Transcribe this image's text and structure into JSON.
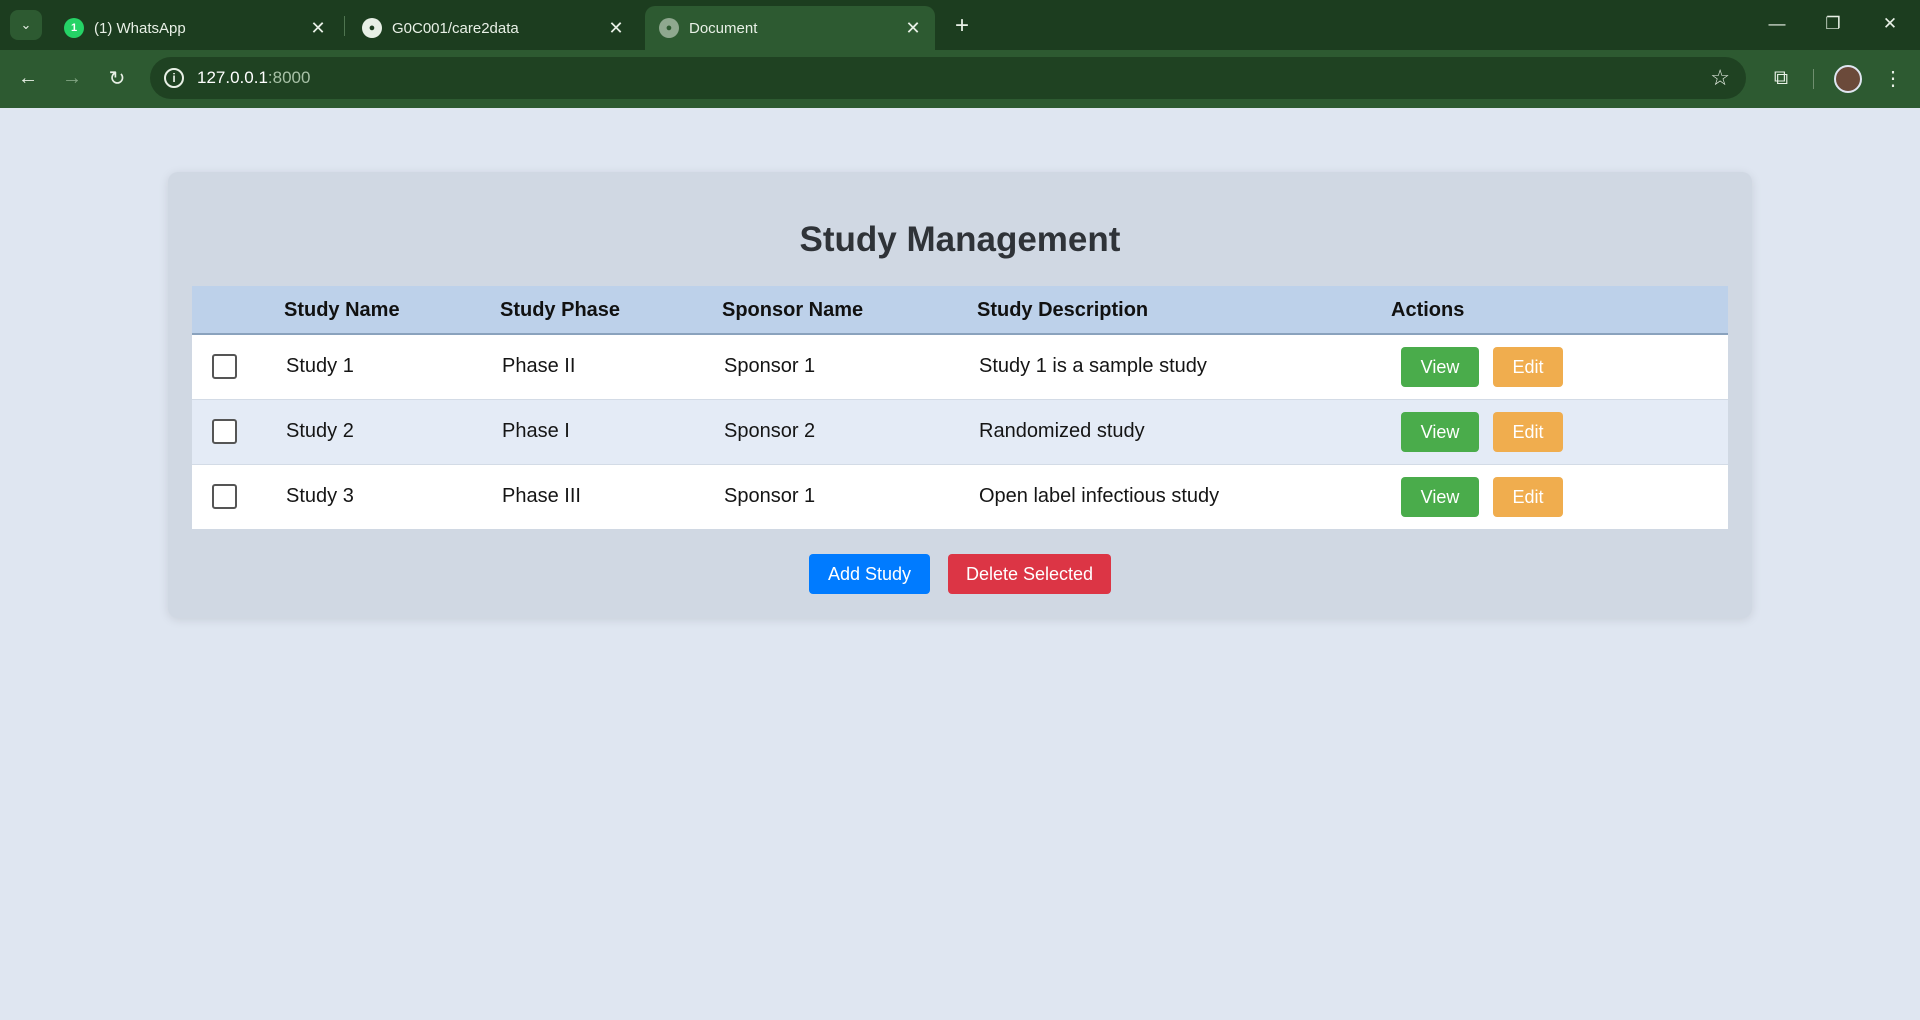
{
  "browser": {
    "tabs": [
      {
        "label": "(1) WhatsApp",
        "icon": "whatsapp-icon",
        "active": false
      },
      {
        "label": "G0C001/care2data",
        "icon": "github-icon",
        "active": false
      },
      {
        "label": "Document",
        "icon": "globe-icon",
        "active": true
      }
    ],
    "url_host": "127.0.0.1",
    "url_port": ":8000"
  },
  "page": {
    "title": "Study Management",
    "columns": [
      "",
      "Study Name",
      "Study Phase",
      "Sponsor Name",
      "Study Description",
      "Actions"
    ],
    "rows": [
      {
        "name": "Study 1",
        "phase": "Phase II",
        "sponsor": "Sponsor 1",
        "description": "Study 1 is a sample study",
        "checked": false
      },
      {
        "name": "Study 2",
        "phase": "Phase I",
        "sponsor": "Sponsor 2",
        "description": "Randomized study",
        "checked": false
      },
      {
        "name": "Study 3",
        "phase": "Phase III",
        "sponsor": "Sponsor 1",
        "description": "Open label infectious study",
        "checked": false
      }
    ],
    "view_label": "View",
    "edit_label": "Edit",
    "add_label": "Add Study",
    "delete_label": "Delete Selected"
  },
  "colors": {
    "view": "#4aac4b",
    "edit": "#f0ad4e",
    "add": "#007bff",
    "delete": "#dc3545",
    "chrome": "#2d5a31"
  }
}
